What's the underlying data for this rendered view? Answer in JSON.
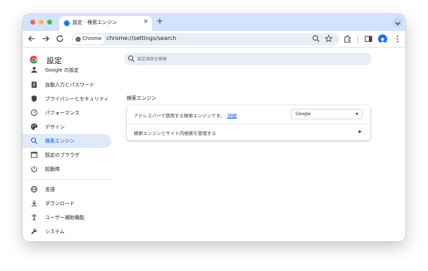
{
  "window": {
    "tab_title": "設定 - 検索エンジン",
    "newtab_symbol": "+",
    "close_symbol": "×"
  },
  "toolbar": {
    "chip_label": "Chrome",
    "url": "chrome://settings/search"
  },
  "settings": {
    "title": "設定",
    "search_placeholder": "設定項目を検索",
    "nav_items": [
      {
        "label": "Google の設定",
        "icon": "person-icon"
      },
      {
        "label": "自動入力とパスワード",
        "icon": "clipboard-icon"
      },
      {
        "label": "プライバシーとセキュリティ",
        "icon": "shield-icon"
      },
      {
        "label": "パフォーマンス",
        "icon": "speedometer-icon"
      },
      {
        "label": "デザイン",
        "icon": "palette-icon"
      },
      {
        "label": "検索エンジン",
        "icon": "search-icon",
        "active": true
      },
      {
        "label": "既定のブラウザ",
        "icon": "browser-icon"
      },
      {
        "label": "起動時",
        "icon": "power-icon"
      },
      {
        "label": "言語",
        "icon": "globe-icon"
      },
      {
        "label": "ダウンロード",
        "icon": "download-icon"
      },
      {
        "label": "ユーザー補助機能",
        "icon": "accessibility-icon"
      },
      {
        "label": "システム",
        "icon": "wrench-icon"
      }
    ],
    "section_title": "検索エンジン",
    "row1_label": "アドレスバーで使用する検索エンジンです。",
    "row1_link": "詳細",
    "row1_select_value": "Google",
    "row2_label": "検索エンジンとサイト内検索を管理する"
  },
  "colors": {
    "accent": "#0b57d0",
    "active_bg": "#e1e9f8",
    "tabstrip": "#d3e3fd"
  }
}
